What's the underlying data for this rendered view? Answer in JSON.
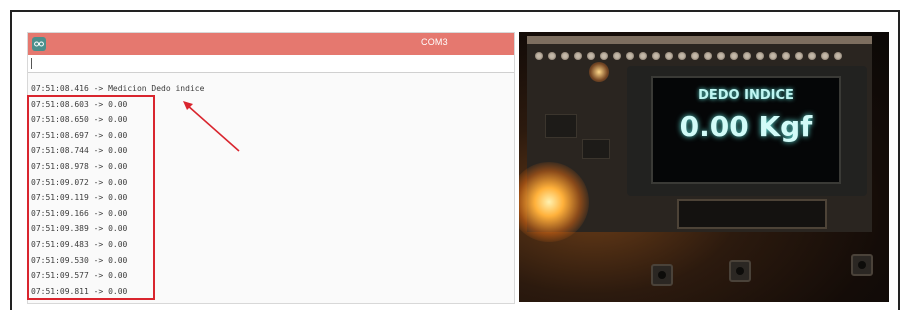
{
  "serial_monitor": {
    "window_title": "COM3",
    "input_value": "",
    "lines": [
      "07:51:08.416 -> Medicion Dedo indice",
      "07:51:08.603 -> 0.00",
      "07:51:08.650 -> 0.00",
      "07:51:08.697 -> 0.00",
      "07:51:08.744 -> 0.00",
      "07:51:08.978 -> 0.00",
      "07:51:09.072 -> 0.00",
      "07:51:09.119 -> 0.00",
      "07:51:09.166 -> 0.00",
      "07:51:09.389 -> 0.00",
      "07:51:09.483 -> 0.00",
      "07:51:09.530 -> 0.00",
      "07:51:09.577 -> 0.00",
      "07:51:09.811 -> 0.00"
    ]
  },
  "device_display": {
    "title": "DEDO INDICE",
    "value": "0.00 Kgf"
  },
  "colors": {
    "titlebar": "#e5786f",
    "highlight": "#d9252e",
    "oled_text": "#bff6f2"
  }
}
